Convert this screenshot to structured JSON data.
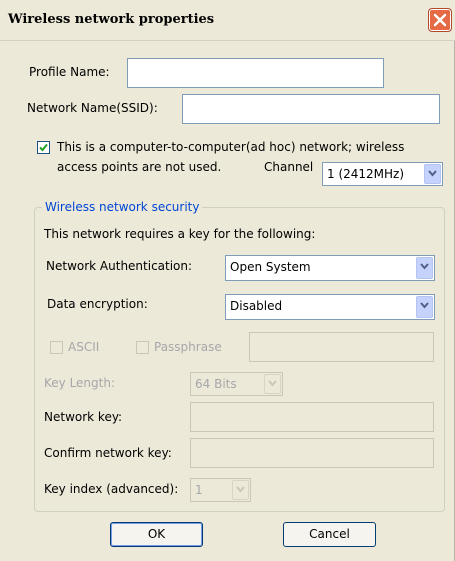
{
  "window": {
    "title": "Wireless network properties"
  },
  "profile": {
    "label": "Profile Name:",
    "value": ""
  },
  "ssid": {
    "label": "Network Name(SSID):",
    "value": ""
  },
  "adhoc": {
    "checked": true,
    "label_line1": "This is a computer-to-computer(ad hoc) network; wireless",
    "label_line2": "access points are not used.",
    "channel_label": "Channel",
    "channel_value": "1  (2412MHz)"
  },
  "security": {
    "group_title": "Wireless network security",
    "intro": "This network requires a key for the following:",
    "auth_label": "Network Authentication:",
    "auth_value": "Open System",
    "encryption_label": "Data encryption:",
    "encryption_value": "Disabled",
    "ascii_label": "ASCII",
    "passphrase_label": "Passphrase",
    "key_length_label": "Key Length:",
    "key_length_value": "64 Bits",
    "network_key_label": "Network key:",
    "confirm_key_label": "Confirm network key:",
    "key_index_label": "Key index (advanced):",
    "key_index_value": "1"
  },
  "buttons": {
    "ok": "OK",
    "cancel": "Cancel"
  },
  "icons": {
    "close": "close-icon",
    "check": "checkmark-icon",
    "dropdown": "chevron-down-icon"
  },
  "colors": {
    "accent": "#0046d5",
    "close_button": "#e46b45"
  }
}
